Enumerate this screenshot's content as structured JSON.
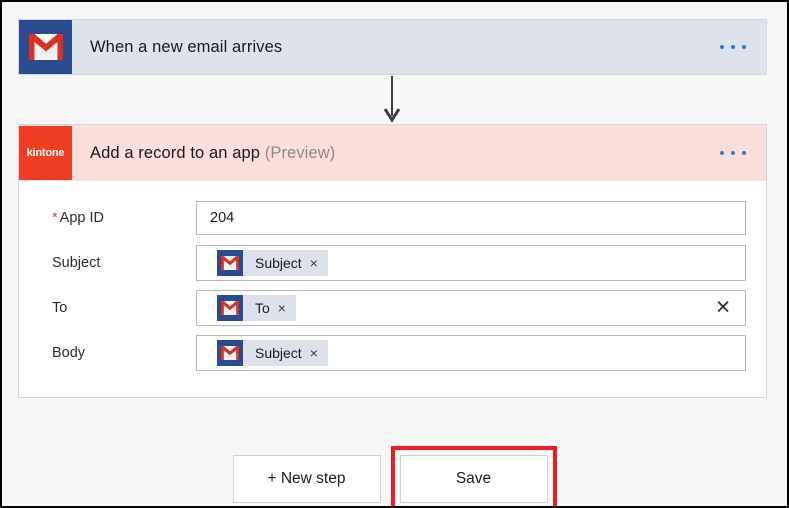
{
  "flow": {
    "trigger": {
      "icon": "gmail-icon",
      "title": "When a new email arrives",
      "menu_label": "…",
      "header_color": "#dee2e9",
      "logo_color": "#2a4b8d"
    },
    "connector": {
      "icon": "down-arrow-icon"
    },
    "action": {
      "icon": "kintone-icon",
      "logo_text": "kintone",
      "title": "Add a record to an app",
      "title_suffix": "(Preview)",
      "menu_label": "…",
      "header_color": "#fcdfdb",
      "logo_color": "#ef3d23",
      "fields": [
        {
          "label": "App ID",
          "required": true,
          "required_marker": "*",
          "value": "204",
          "chips": [],
          "has_clear": false
        },
        {
          "label": "Subject",
          "required": false,
          "required_marker": "",
          "value": "",
          "chips": [
            {
              "icon": "gmail-icon",
              "label": "Subject",
              "close": "×"
            }
          ],
          "has_clear": false
        },
        {
          "label": "To",
          "required": false,
          "required_marker": "",
          "value": "",
          "chips": [
            {
              "icon": "gmail-icon",
              "label": "To",
              "close": "×"
            }
          ],
          "has_clear": true,
          "clear_glyph": "✕"
        },
        {
          "label": "Body",
          "required": false,
          "required_marker": "",
          "value": "",
          "chips": [
            {
              "icon": "gmail-icon",
              "label": "Subject",
              "close": "×"
            }
          ],
          "has_clear": false
        }
      ]
    }
  },
  "footer": {
    "new_step_label": "+ New step",
    "save_label": "Save",
    "highlight_color": "#ee1c25"
  }
}
